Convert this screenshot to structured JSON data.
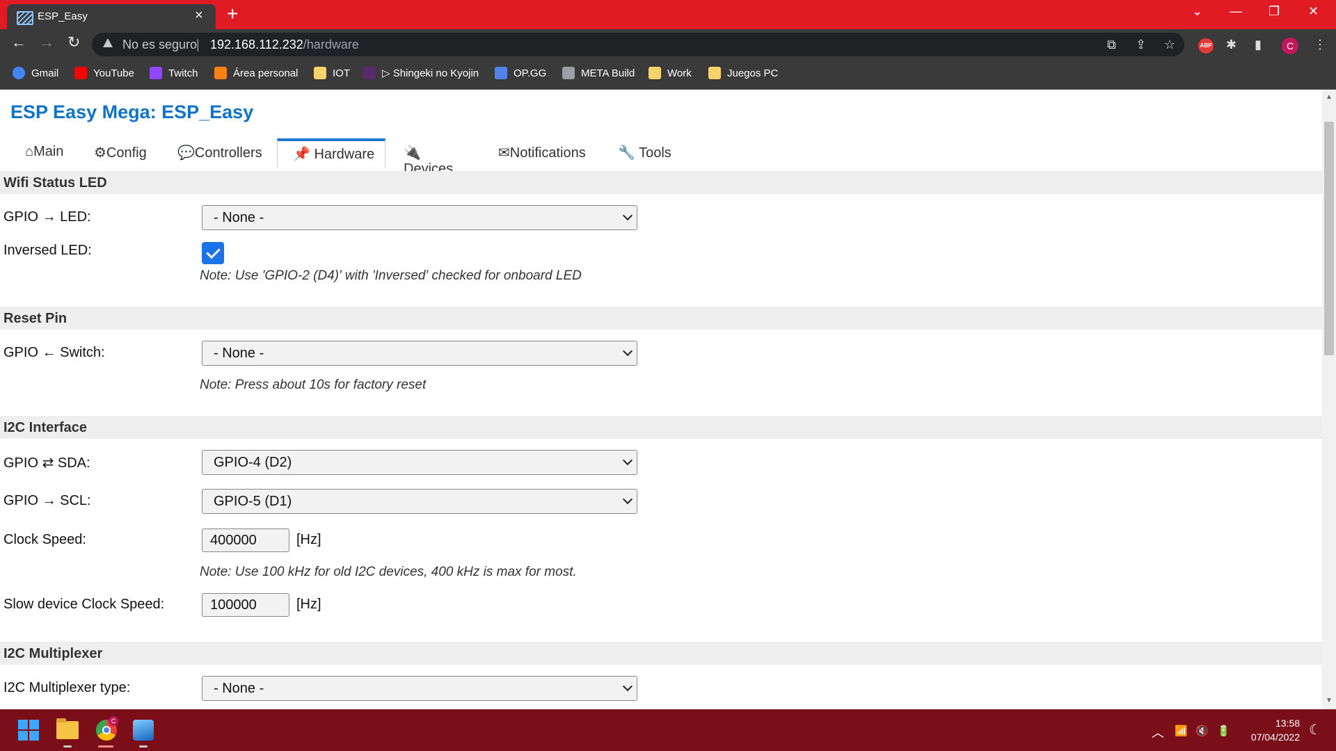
{
  "browser": {
    "tab_title": "ESP_Easy",
    "tab_close": "×",
    "new_tab": "+",
    "window_controls": {
      "tab_search": "⌄",
      "minimize": "—",
      "restore": "❐",
      "close": "✕"
    },
    "nav": {
      "back": "←",
      "forward": "→",
      "reload": "↻"
    },
    "security_label": "No es seguro",
    "separator": "|",
    "url_host": "192.168.112.232",
    "url_path": "/hardware",
    "toolbar_icons": [
      "translate-icon",
      "share-icon",
      "star-icon",
      "adblock-icon",
      "extensions-icon",
      "sidepanel-icon",
      "profile-icon",
      "menu-icon"
    ],
    "abp_label": "ABP",
    "profile_initial": "C",
    "menu": "⋮",
    "bookmarks": [
      {
        "label": "Gmail",
        "icon": "google-icon",
        "color": "#4285f4"
      },
      {
        "label": "YouTube",
        "icon": "youtube-icon",
        "color": "#ff0000"
      },
      {
        "label": "Twitch",
        "icon": "twitch-icon",
        "color": "#9146ff"
      },
      {
        "label": "Área personal",
        "icon": "moodle-icon",
        "color": "#f98012"
      },
      {
        "label": "IOT",
        "icon": "folder-icon",
        "color": "#f6d36b"
      },
      {
        "label": "▷ Shingeki no Kyojin",
        "icon": "anime-icon",
        "color": "#5a2a6e"
      },
      {
        "label": "OP.GG",
        "icon": "opgg-icon",
        "color": "#5383e8"
      },
      {
        "label": "META Build",
        "icon": "metabuild-icon",
        "color": "#9aa0a6"
      },
      {
        "label": "Work",
        "icon": "folder-icon",
        "color": "#f6d36b"
      },
      {
        "label": "Juegos PC",
        "icon": "folder-icon",
        "color": "#f6d36b"
      }
    ]
  },
  "page": {
    "title": "ESP Easy Mega: ESP_Easy",
    "tabs": [
      {
        "label": "⌂Main",
        "active": false
      },
      {
        "label": "⚙Config",
        "active": false
      },
      {
        "label": "💬Controllers",
        "active": false
      },
      {
        "label": "📌 Hardware",
        "active": true
      },
      {
        "label": "🔌 Devices",
        "active": false
      },
      {
        "label": "✉Notifications",
        "active": false
      },
      {
        "label": "🔧 Tools",
        "active": false
      }
    ],
    "sections": {
      "wifi_led": {
        "header": "Wifi Status LED",
        "gpio_label": "GPIO → LED:",
        "gpio_value": "- None -",
        "inversed_label": "Inversed LED:",
        "inversed_checked": true,
        "note": "Note: Use 'GPIO-2 (D4)' with 'Inversed' checked for onboard LED"
      },
      "reset_pin": {
        "header": "Reset Pin",
        "gpio_label": "GPIO ← Switch:",
        "gpio_value": "- None -",
        "note": "Note: Press about 10s for factory reset"
      },
      "i2c": {
        "header": "I2C Interface",
        "sda_label": "GPIO ⇄ SDA:",
        "sda_value": "GPIO-4 (D2)",
        "scl_label": "GPIO → SCL:",
        "scl_value": "GPIO-5 (D1)",
        "clock_label": "Clock Speed:",
        "clock_value": "400000",
        "clock_unit": "[Hz]",
        "note": "Note: Use 100 kHz for old I2C devices, 400 kHz is max for most.",
        "slow_label": "Slow device Clock Speed:",
        "slow_value": "100000",
        "slow_unit": "[Hz]"
      },
      "mux": {
        "header": "I2C Multiplexer",
        "type_label": "I2C Multiplexer type:",
        "type_value": "- None -"
      }
    }
  },
  "taskbar": {
    "chrome_badge": "C",
    "tray": {
      "chevron": "︿",
      "wifi": "📶",
      "volume": "🔇",
      "battery": "🔋",
      "moon": "☾"
    },
    "time": "13:58",
    "date": "07/04/2022"
  }
}
